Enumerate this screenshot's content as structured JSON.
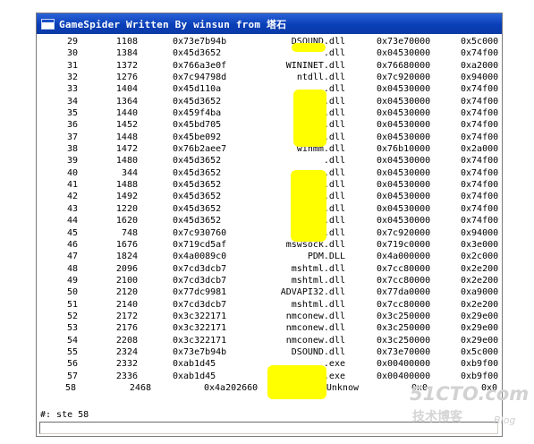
{
  "window": {
    "title": "GameSpider Written By winsun from 塔石"
  },
  "rows": [
    [
      "29",
      "1108",
      "0x73e7b94b",
      "DSOUND.dll",
      "0x73e70000",
      "0x5c000"
    ],
    [
      "30",
      "1384",
      "0x45d3652",
      ".dll",
      "0x04530000",
      "0x74f00"
    ],
    [
      "31",
      "1372",
      "0x766a3e0f",
      "WININET.dll",
      "0x76680000",
      "0xa2000"
    ],
    [
      "32",
      "1276",
      "0x7c94798d",
      "ntdll.dll",
      "0x7c920000",
      "0x94000"
    ],
    [
      "33",
      "1404",
      "0x45d110a",
      ".dll",
      "0x04530000",
      "0x74f00"
    ],
    [
      "34",
      "1364",
      "0x45d3652",
      ".dll",
      "0x04530000",
      "0x74f00"
    ],
    [
      "35",
      "1440",
      "0x459f4ba",
      ".dll",
      "0x04530000",
      "0x74f00"
    ],
    [
      "36",
      "1452",
      "0x45bd705",
      ".dll",
      "0x04530000",
      "0x74f00"
    ],
    [
      "37",
      "1448",
      "0x45be092",
      ".dll",
      "0x04530000",
      "0x74f00"
    ],
    [
      "38",
      "1472",
      "0x76b2aee7",
      "winmm.dll",
      "0x76b10000",
      "0x2a000"
    ],
    [
      "39",
      "1480",
      "0x45d3652",
      ".dll",
      "0x04530000",
      "0x74f00"
    ],
    [
      "40",
      "344",
      "0x45d3652",
      ".dll",
      "0x04530000",
      "0x74f00"
    ],
    [
      "41",
      "1488",
      "0x45d3652",
      ".dll",
      "0x04530000",
      "0x74f00"
    ],
    [
      "42",
      "1492",
      "0x45d3652",
      ".dll",
      "0x04530000",
      "0x74f00"
    ],
    [
      "43",
      "1220",
      "0x45d3652",
      ".dll",
      "0x04530000",
      "0x74f00"
    ],
    [
      "44",
      "1620",
      "0x45d3652",
      ".dll",
      "0x04530000",
      "0x74f00"
    ],
    [
      "45",
      "748",
      "0x7c930760",
      "ntdll.dll",
      "0x7c920000",
      "0x94000"
    ],
    [
      "46",
      "1676",
      "0x719cd5af",
      "mswsock.dll",
      "0x719c0000",
      "0x3e000"
    ],
    [
      "47",
      "1824",
      "0x4a0089c0",
      "PDM.DLL",
      "0x4a000000",
      "0x2c000"
    ],
    [
      "48",
      "2096",
      "0x7cd3dcb7",
      "mshtml.dll",
      "0x7cc80000",
      "0x2e200"
    ],
    [
      "49",
      "2100",
      "0x7cd3dcb7",
      "mshtml.dll",
      "0x7cc80000",
      "0x2e200"
    ],
    [
      "50",
      "2120",
      "0x77dc9981",
      "ADVAPI32.dll",
      "0x77da0000",
      "0xa9000"
    ],
    [
      "51",
      "2140",
      "0x7cd3dcb7",
      "mshtml.dll",
      "0x7cc80000",
      "0x2e200"
    ],
    [
      "52",
      "2172",
      "0x3c322171",
      "nmconew.dll",
      "0x3c250000",
      "0x29e00"
    ],
    [
      "53",
      "2176",
      "0x3c322171",
      "nmconew.dll",
      "0x3c250000",
      "0x29e00"
    ],
    [
      "54",
      "2208",
      "0x3c322171",
      "nmconew.dll",
      "0x3c250000",
      "0x29e00"
    ],
    [
      "55",
      "2324",
      "0x73e7b94b",
      "DSOUND.dll",
      "0x73e70000",
      "0x5c000"
    ],
    [
      "56",
      "2332",
      "0xab1d45",
      ".exe",
      "0x00400000",
      "0xb9f00"
    ],
    [
      "57",
      "2336",
      "0xab1d45",
      ".exe",
      "0x00400000",
      "0xb9f00"
    ]
  ],
  "last_row": [
    "58",
    "2468",
    "0x4a202660",
    "Unknow",
    "0x0",
    "0x0"
  ],
  "status": {
    "text": "#: ste 58"
  },
  "watermark": {
    "line1": "51CTO.com",
    "line2": "技术博客",
    "line3": "Blog"
  },
  "colors": {
    "titlebar": "#0a3fb8",
    "highlight": "#ffff00"
  }
}
